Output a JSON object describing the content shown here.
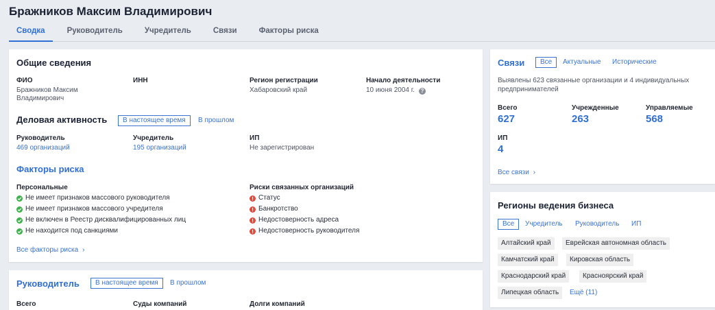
{
  "page_title": "Бражников Максим Владимирович",
  "tabs": [
    {
      "label": "Сводка",
      "active": true
    },
    {
      "label": "Руководитель"
    },
    {
      "label": "Учредитель"
    },
    {
      "label": "Связи"
    },
    {
      "label": "Факторы риска"
    }
  ],
  "general": {
    "title": "Общие сведения",
    "fio_label": "ФИО",
    "fio_line1": "Бражников Максим",
    "fio_line2": "Владимирович",
    "inn_label": "ИНН",
    "region_label": "Регион регистрации",
    "region_value": "Хабаровский край",
    "start_label": "Начало деятельности",
    "start_value": "10 июня 2004 г.",
    "help_glyph": "?"
  },
  "business": {
    "title": "Деловая активность",
    "toggle_now": "В настоящее время",
    "toggle_past": "В прошлом",
    "manager_label": "Руководитель",
    "manager_value": "469 организаций",
    "founder_label": "Учредитель",
    "founder_value": "195 организаций",
    "ip_label": "ИП",
    "ip_value": "Не зарегистрирован"
  },
  "risks": {
    "title": "Факторы риска",
    "personal_label": "Персональные",
    "personal": [
      "Не имеет признаков массового руководителя",
      "Не имеет признаков массового учредителя",
      "Не включен в Реестр дисквалифицированных лиц",
      "Не находится под санкциями"
    ],
    "related_label": "Риски связанных организаций",
    "related": [
      "Статус",
      "Банкротство",
      "Недостоверность адреса",
      "Недостоверность руководителя"
    ],
    "all_link": "Все факторы риска",
    "chevron": "›"
  },
  "manager_card": {
    "title": "Руководитель",
    "toggle_now": "В настоящее время",
    "toggle_past": "В прошлом",
    "col1": "Всего",
    "col2": "Суды компаний",
    "col3": "Долги компаний"
  },
  "links_card": {
    "title": "Связи",
    "filter_all": "Все",
    "filter_actual": "Актуальные",
    "filter_historic": "Исторические",
    "summary": "Выявлены 623 связанные организации и 4 индивидуальных предпринимателей",
    "total_label": "Всего",
    "total_value": "627",
    "founded_label": "Учрежденные",
    "founded_value": "263",
    "managed_label": "Управляемые",
    "managed_value": "568",
    "ip_label": "ИП",
    "ip_value": "4",
    "all_link": "Все связи",
    "chevron": "›"
  },
  "regions_card": {
    "title": "Регионы ведения бизнеса",
    "filter_all": "Все",
    "filter_founder": "Учредитель",
    "filter_manager": "Руководитель",
    "filter_ip": "ИП",
    "regions": [
      "Алтайский край",
      "Еврейская автономная область",
      "Камчатский край",
      "Кировская область",
      "Краснодарский край",
      "Красноярский край",
      "Липецкая область"
    ],
    "more_link": "Ещё (11)"
  },
  "colors": {
    "accent": "#2f6fd6",
    "ok": "#3cb24a",
    "risk": "#e24a3b",
    "background": "#e9ecf0"
  }
}
